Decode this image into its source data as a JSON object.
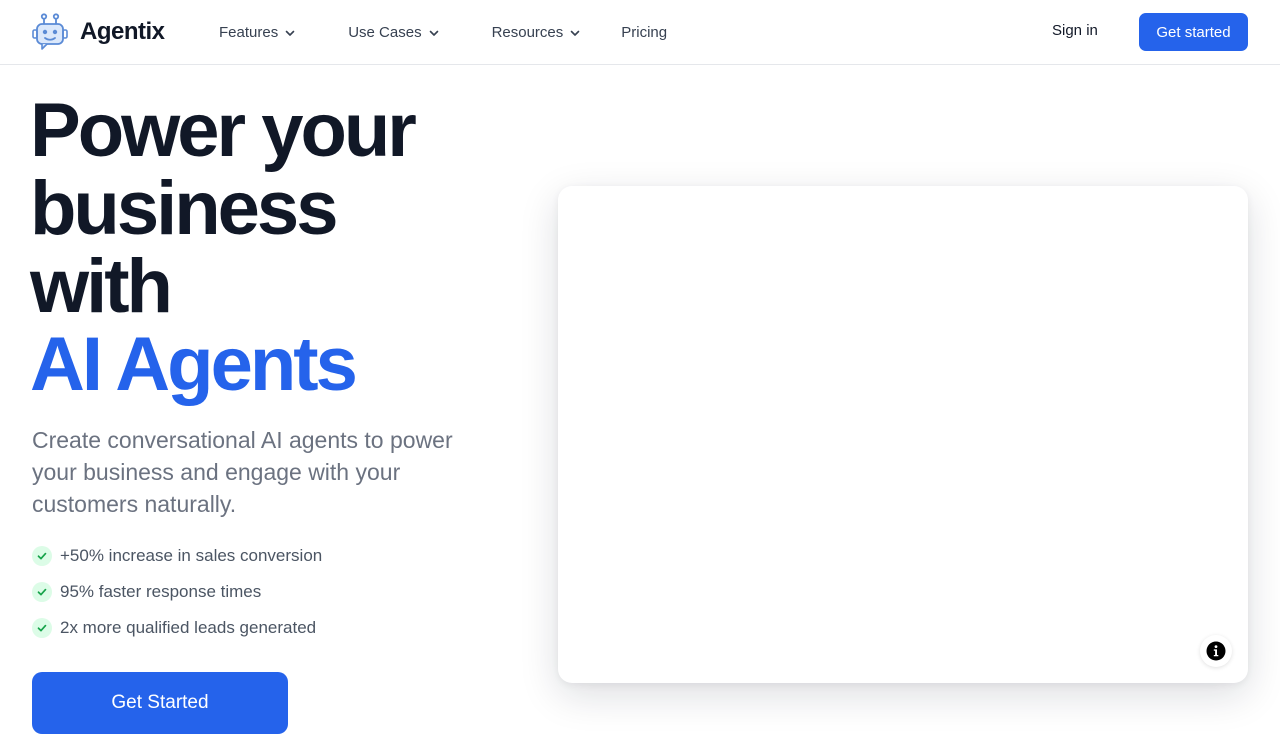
{
  "header": {
    "brand": "Agentix",
    "nav": [
      {
        "label": "Features",
        "has_dropdown": true
      },
      {
        "label": "Use Cases",
        "has_dropdown": true
      },
      {
        "label": "Resources",
        "has_dropdown": true
      },
      {
        "label": "Pricing",
        "has_dropdown": false
      }
    ],
    "sign_in_label": "Sign in",
    "cta_label": "Get started"
  },
  "hero": {
    "title_lines": [
      "Power your",
      "business",
      "with"
    ],
    "title_accent": "AI Agents",
    "subtitle": "Create conversational AI agents to power your business and engage with your customers naturally.",
    "features": [
      "+50% increase in sales conversion",
      "95% faster response times",
      "2x more qualified leads generated"
    ],
    "cta_label": "Get Started"
  },
  "icons": {
    "logo": "robot-icon",
    "dropdown": "chevron-down-icon",
    "feature_check": "check-icon",
    "info": "info-icon"
  },
  "colors": {
    "brand_blue": "#2563eb",
    "heading": "#111827",
    "body_text": "#6b7280",
    "check_bg": "#dcfce7",
    "check_fg": "#16a34a",
    "logo_blue": "#5b8bd6"
  }
}
